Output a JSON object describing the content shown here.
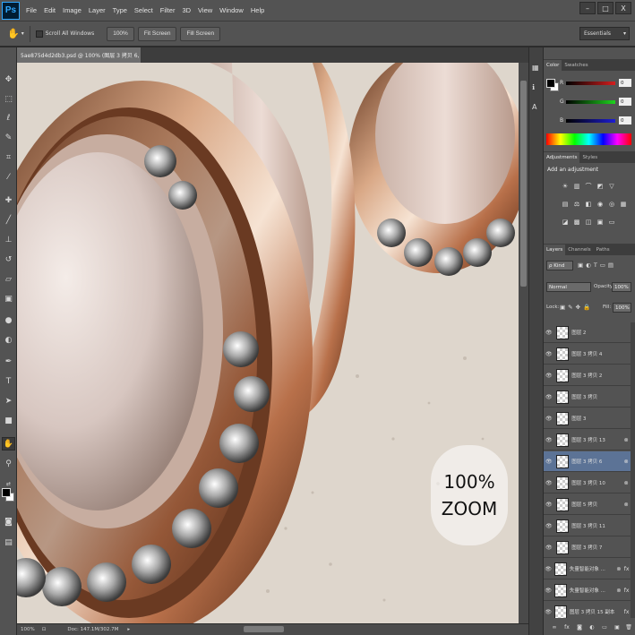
{
  "app": {
    "logo": "Ps"
  },
  "menu": [
    "File",
    "Edit",
    "Image",
    "Layer",
    "Type",
    "Select",
    "Filter",
    "3D",
    "View",
    "Window",
    "Help"
  ],
  "window_controls": {
    "minimize": "–",
    "maximize": "□",
    "close": "X"
  },
  "options_bar": {
    "scroll_all_label": "Scroll All Windows",
    "btn_100": "100%",
    "btn_fit": "Fit Screen",
    "btn_fill": "Fill Screen",
    "workspace": "Essentials"
  },
  "document": {
    "tab_title": "5ae875d4d2db3.psd @ 100% (图层 3 拷贝 6, RGB/8)",
    "watermark_line1": "100%",
    "watermark_line2": "ZOOM"
  },
  "status": {
    "zoom": "100%",
    "doc_info": "Doc: 147.1M/302.7M"
  },
  "tools": [
    "move-icon",
    "marquee-icon",
    "lasso-icon",
    "quick-select-icon",
    "crop-icon",
    "eyedropper-icon",
    "healing-icon",
    "brush-icon",
    "stamp-icon",
    "history-brush-icon",
    "eraser-icon",
    "gradient-icon",
    "blur-icon",
    "dodge-icon",
    "pen-icon",
    "type-icon",
    "path-select-icon",
    "shape-icon",
    "hand-icon",
    "zoom-icon"
  ],
  "color_panel": {
    "tabs": [
      "Color",
      "Swatches"
    ],
    "r": "0",
    "g": "0",
    "b": "0",
    "r_label": "R",
    "g_label": "G",
    "b_label": "B",
    "accent_red": "#d41e1e",
    "accent_green": "#1ed41e",
    "accent_blue": "#1e1ed4"
  },
  "adjustments_panel": {
    "tabs": [
      "Adjustments",
      "Styles"
    ],
    "heading": "Add an adjustment"
  },
  "layers_panel": {
    "tabs": [
      "Layers",
      "Channels",
      "Paths"
    ],
    "kind": "ρ Kind",
    "blend_mode": "Normal",
    "opacity_label": "Opacity:",
    "opacity": "100%",
    "lock_label": "Lock:",
    "fill_label": "Fill:",
    "fill": "100%",
    "layers": [
      {
        "name": "图层 2",
        "link": false,
        "fx": false,
        "selected": false
      },
      {
        "name": "图层 3 拷贝 4",
        "link": false,
        "fx": false,
        "selected": false
      },
      {
        "name": "图层 3 拷贝 2",
        "link": false,
        "fx": false,
        "selected": false
      },
      {
        "name": "图层 3 拷贝",
        "link": false,
        "fx": false,
        "selected": false
      },
      {
        "name": "图层 3",
        "link": false,
        "fx": false,
        "selected": false
      },
      {
        "name": "图层 3 拷贝 13",
        "link": true,
        "fx": false,
        "selected": false
      },
      {
        "name": "图层 3 拷贝 6",
        "link": true,
        "fx": false,
        "selected": true
      },
      {
        "name": "图层 3 拷贝 10",
        "link": true,
        "fx": false,
        "selected": false
      },
      {
        "name": "图层 5 拷贝",
        "link": true,
        "fx": false,
        "selected": false
      },
      {
        "name": "图层 3 拷贝 11",
        "link": false,
        "fx": false,
        "selected": false
      },
      {
        "name": "图层 3 拷贝 7",
        "link": false,
        "fx": false,
        "selected": false
      },
      {
        "name": "失量智能对象 ...",
        "link": true,
        "fx": true,
        "selected": false
      },
      {
        "name": "失量智能对象 ...",
        "link": true,
        "fx": true,
        "selected": false
      },
      {
        "name": "图层 3 拷贝 15 副本",
        "link": false,
        "fx": true,
        "selected": false
      }
    ]
  }
}
